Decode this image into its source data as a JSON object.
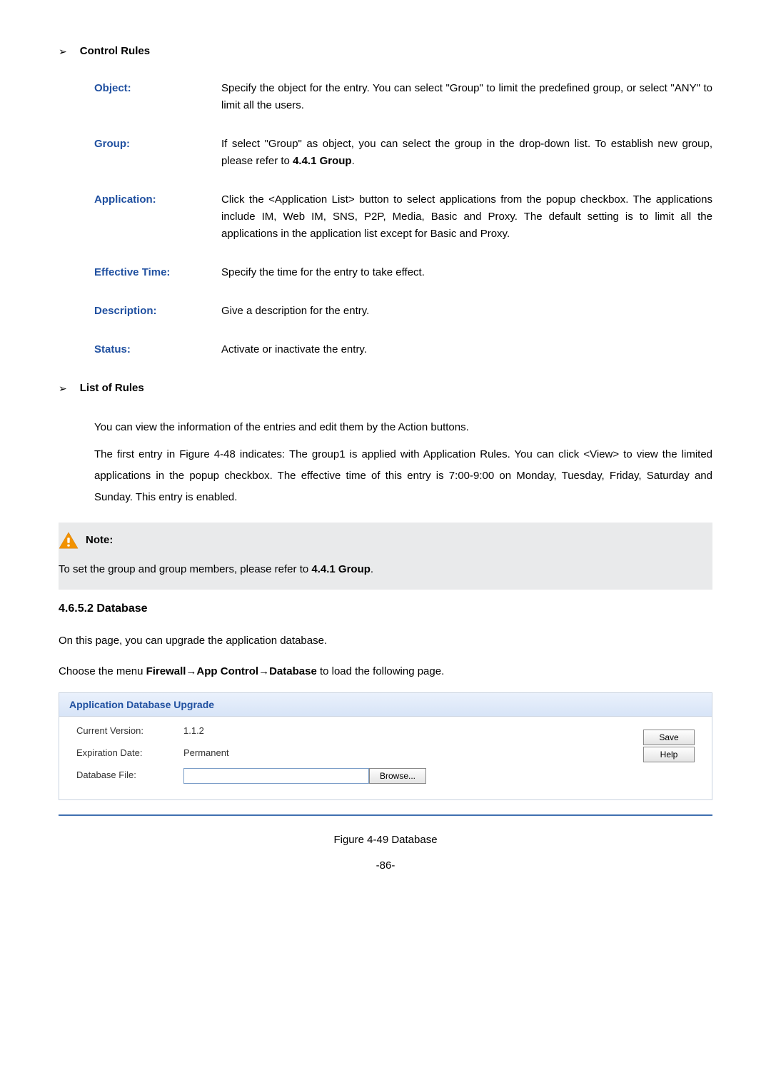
{
  "control_rules": {
    "section_title": "Control Rules",
    "items": [
      {
        "term": "Object:",
        "desc": "Specify the object for the entry. You can select \"Group\" to limit the predefined group, or select \"ANY\" to limit all the users."
      },
      {
        "term": "Group:",
        "desc_pre": "If select \"Group\" as object, you can select the group in the drop-down list. To establish new group, please refer to ",
        "desc_bold": "4.4.1 Group",
        "desc_post": "."
      },
      {
        "term": "Application:",
        "desc": "Click the <Application List> button to select applications from the popup checkbox. The applications include IM, Web IM, SNS, P2P, Media, Basic and Proxy. The default setting is to limit all the applications in the application list except for Basic and Proxy."
      },
      {
        "term": "Effective Time:",
        "desc": "Specify the time for the entry to take effect."
      },
      {
        "term": "Description:",
        "desc": "Give a description for the entry."
      },
      {
        "term": "Status:",
        "desc": "Activate or inactivate the entry."
      }
    ]
  },
  "list_of_rules": {
    "section_title": "List of Rules",
    "para1": "You can view the information of the entries and edit them by the Action buttons.",
    "para2": "The first entry in Figure 4-48 indicates: The group1 is applied with Application Rules. You can click <View> to view the limited applications in the popup checkbox. The effective time of this entry is 7:00-9:00 on Monday, Tuesday, Friday, Saturday and Sunday. This entry is enabled."
  },
  "note": {
    "label": "Note:",
    "text_pre": "To set the group and group members, please refer to ",
    "text_bold": "4.4.1 Group",
    "text_post": "."
  },
  "heading": "4.6.5.2    Database",
  "body1": "On this page, you can upgrade the application database.",
  "body2_pre": "Choose the menu ",
  "body2_bold": "Firewall→App Control→Database",
  "body2_post": " to load the following page.",
  "panel": {
    "title": "Application Database Upgrade",
    "version_label": "Current Version:",
    "version_value": "1.1.2",
    "expiration_label": "Expiration Date:",
    "expiration_value": "Permanent",
    "file_label": "Database File:",
    "browse": "Browse...",
    "save": "Save",
    "help": "Help"
  },
  "figure_caption": "Figure 4-49 Database",
  "page_number": "-86-"
}
